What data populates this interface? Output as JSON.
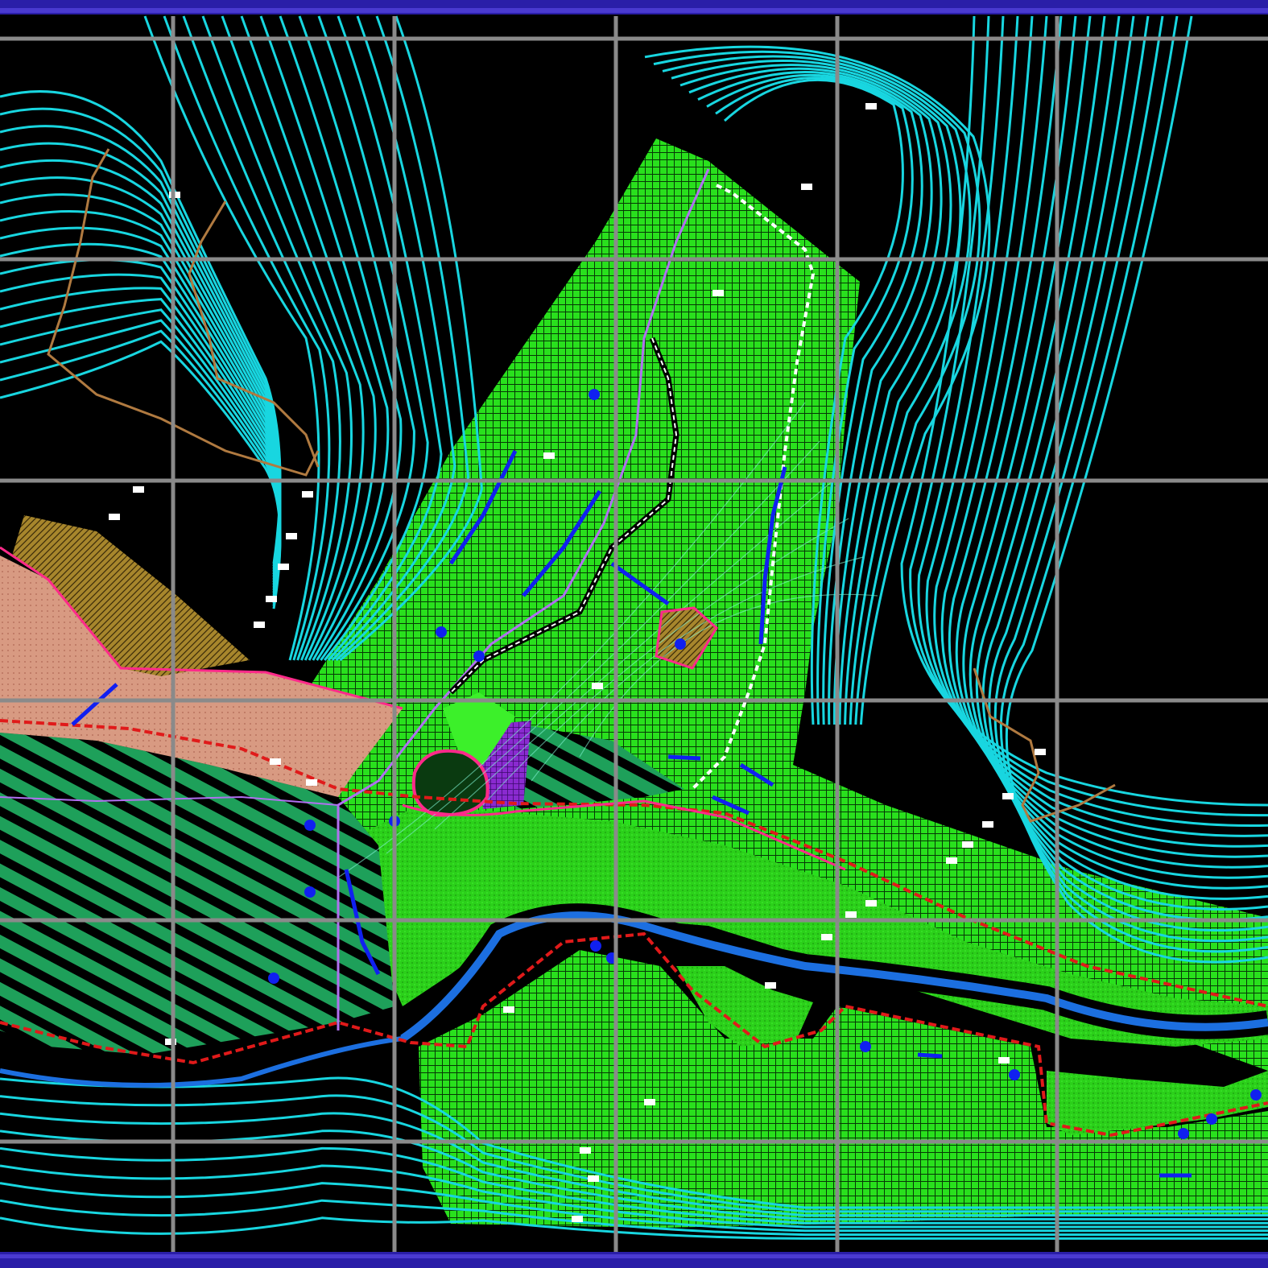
{
  "map": {
    "background": "#000000",
    "frame_color": "#2a1ea8",
    "grid_color": "#8a8a8a",
    "contour_color": "#18d6e0",
    "grid_labels": [
      "",
      "",
      "",
      "",
      "",
      ""
    ],
    "layers": [
      {
        "name": "contour-lines",
        "color": "#18d6e0"
      },
      {
        "name": "grid-lines",
        "color": "#8a8a8a"
      },
      {
        "name": "forest-area",
        "color": "#29e01d"
      },
      {
        "name": "meadow-area",
        "color": "#2bcf1a"
      },
      {
        "name": "orchard-strips",
        "color": "#1ea05a"
      },
      {
        "name": "settlement-area",
        "color": "#d89a82"
      },
      {
        "name": "shrub-area",
        "color": "#a7862c"
      },
      {
        "name": "river",
        "color": "#1c6fe0"
      },
      {
        "name": "parcel-boundary",
        "color": "#ff2a8a"
      },
      {
        "name": "road-boundary",
        "color": "#e01a1a"
      },
      {
        "name": "path",
        "color": "#b070f0"
      },
      {
        "name": "trail-dashed",
        "color": "#ffffff"
      },
      {
        "name": "stream-ditch",
        "color": "#1020f0"
      },
      {
        "name": "ridge-line",
        "color": "#b07a40"
      }
    ]
  }
}
